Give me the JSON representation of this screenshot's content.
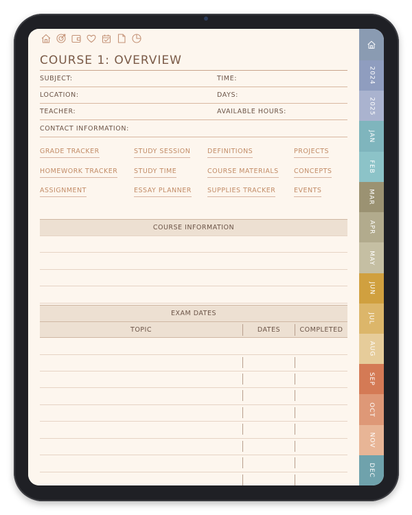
{
  "toolbar": {
    "icons": [
      "home-icon",
      "target-icon",
      "wallet-icon",
      "heart-icon",
      "calendar-icon",
      "note-icon",
      "pie-chart-icon"
    ]
  },
  "page": {
    "title": "COURSE 1: OVERVIEW"
  },
  "fields": {
    "subject": "SUBJECT:",
    "time": "TIME:",
    "location": "LOCATION:",
    "days": "DAYS:",
    "teacher": "TEACHER:",
    "available_hours": "AVAILABLE HOURS:",
    "contact": "CONTACT INFORMATION:"
  },
  "links": {
    "row1": [
      "GRADE TRACKER",
      "STUDY SESSION",
      "DEFINITIONS",
      "PROJECTS"
    ],
    "row2": [
      "HOMEWORK TRACKER",
      "STUDY TIME",
      "COURSE MATERIALS",
      "CONCEPTS"
    ],
    "row3": [
      "ASSIGNMENT",
      "ESSAY PLANNER",
      "SUPPLIES TRACKER",
      "EVENTS"
    ]
  },
  "course_info": {
    "header": "COURSE INFORMATION"
  },
  "exam": {
    "header": "EXAM DATES",
    "columns": [
      "TOPIC",
      "DATES",
      "COMPLETED"
    ]
  },
  "tabs": {
    "labels": [
      "2024",
      "2025",
      "JAN",
      "FEB",
      "MAR",
      "APR",
      "MAY",
      "JUN",
      "JUL",
      "AUG",
      "SEP",
      "OCT",
      "NOV",
      "DEC"
    ],
    "colors": {
      "home": "#8a9bb2",
      "2024": "#8f9dbf",
      "2025": "#aab3cf",
      "JAN": "#7fb5bd",
      "FEB": "#8cc3c8",
      "MAR": "#9b9272",
      "APR": "#b2ab8d",
      "MAY": "#c5bfa3",
      "JUN": "#d0a03f",
      "JUL": "#dcb66a",
      "AUG": "#e6cc9a",
      "SEP": "#d47a55",
      "OCT": "#de9877",
      "NOV": "#e8b596",
      "DEC": "#6fa2ac"
    }
  }
}
